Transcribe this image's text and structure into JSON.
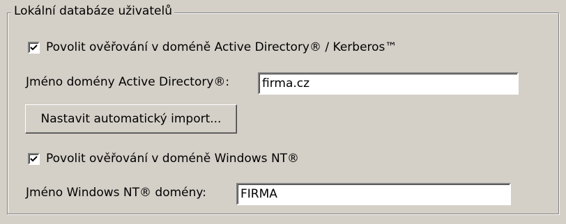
{
  "group": {
    "title": "Lokální databáze uživatelů"
  },
  "ad": {
    "checkbox_label": "Povolit ověřování v doméně Active Directory® / Kerberos™",
    "checked": true,
    "domain_label": "Jméno domény Active Directory®:",
    "domain_value": "firma.cz",
    "import_button": "Nastavit automatický import..."
  },
  "nt": {
    "checkbox_label": "Povolit ověřování v doméně Windows NT®",
    "checked": true,
    "domain_label": "Jméno Windows NT® domény:",
    "domain_value": "FIRMA"
  }
}
